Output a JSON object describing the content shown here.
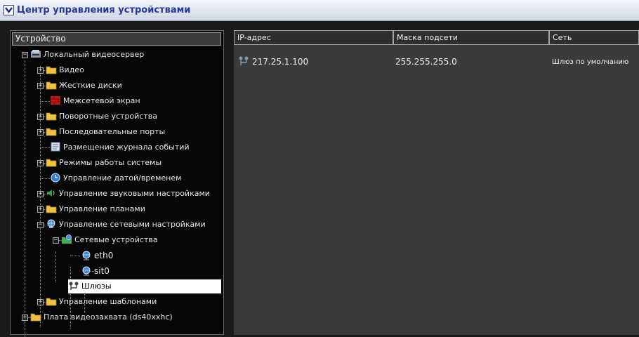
{
  "window": {
    "title": "Центр управления устройствами"
  },
  "tree": {
    "header": "Устройство",
    "nodes": [
      {
        "label": "Локальный видеосервер",
        "icon": "server-icon"
      },
      {
        "label": "Видео",
        "icon": "folder-icon"
      },
      {
        "label": "Жесткие диски",
        "icon": "folder-icon"
      },
      {
        "label": "Межсетевой экран",
        "icon": "firewall-icon"
      },
      {
        "label": "Поворотные устройства",
        "icon": "folder-icon"
      },
      {
        "label": "Последовательные порты",
        "icon": "folder-icon"
      },
      {
        "label": "Размещение журнала событий",
        "icon": "log-icon"
      },
      {
        "label": "Режимы работы системы",
        "icon": "folder-icon"
      },
      {
        "label": "Управление датой/временем",
        "icon": "clock-icon"
      },
      {
        "label": "Управление звуковыми настройками",
        "icon": "sound-icon"
      },
      {
        "label": "Управление планами",
        "icon": "folder-icon"
      },
      {
        "label": "Управление сетевыми настройками",
        "icon": "network-icon"
      },
      {
        "label": "Сетевые устройства",
        "icon": "network-devices-icon"
      },
      {
        "label": "eth0",
        "icon": "interface-icon"
      },
      {
        "label": "sit0",
        "icon": "interface-icon"
      },
      {
        "label": "Шлюзы",
        "icon": "gateway-icon"
      },
      {
        "label": "Управление шаблонами",
        "icon": "folder-icon"
      },
      {
        "label": "Плата видеозахвата (ds40xxhc)",
        "icon": "folder-icon"
      }
    ],
    "selected": "Шлюзы"
  },
  "grid": {
    "columns": [
      "IP-адрес",
      "Маска подсети",
      "Сеть"
    ],
    "rows": [
      {
        "ip": "217.25.1.100",
        "mask": "255.255.255.0",
        "network": "Шлюз по умолчанию"
      }
    ]
  },
  "colors": {
    "title_text": "#23379c",
    "folder": "#f0c040",
    "panel_bg": "#3b3b3b",
    "tree_bg": "#060606"
  }
}
